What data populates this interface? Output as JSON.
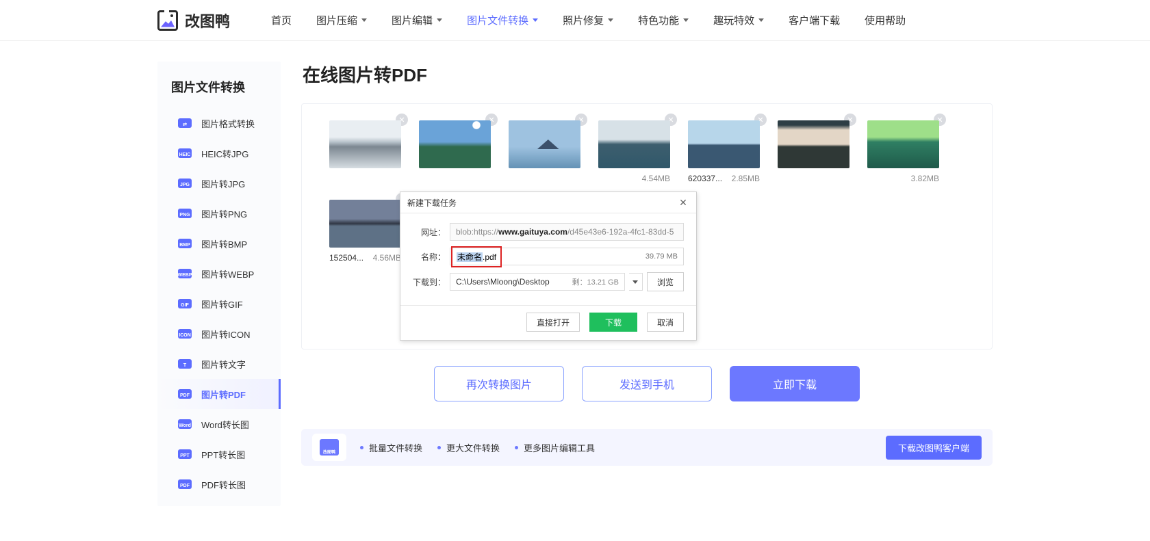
{
  "brand": "改图鸭",
  "header": {
    "nav": [
      {
        "label": "首页",
        "dropdown": false
      },
      {
        "label": "图片压缩",
        "dropdown": true
      },
      {
        "label": "图片编辑",
        "dropdown": true
      },
      {
        "label": "图片文件转换",
        "dropdown": true,
        "active": true
      },
      {
        "label": "照片修复",
        "dropdown": true
      },
      {
        "label": "特色功能",
        "dropdown": true
      },
      {
        "label": "趣玩特效",
        "dropdown": true
      },
      {
        "label": "客户端下载",
        "dropdown": false
      },
      {
        "label": "使用帮助",
        "dropdown": false
      }
    ]
  },
  "sidebar": {
    "title": "图片文件转换",
    "items": [
      {
        "label": "图片格式转换",
        "tag": "⇄"
      },
      {
        "label": "HEIC转JPG",
        "tag": "HEIC"
      },
      {
        "label": "图片转JPG",
        "tag": "JPG"
      },
      {
        "label": "图片转PNG",
        "tag": "PNG"
      },
      {
        "label": "图片转BMP",
        "tag": "BMP"
      },
      {
        "label": "图片转WEBP",
        "tag": "WEBP"
      },
      {
        "label": "图片转GIF",
        "tag": "GIF"
      },
      {
        "label": "图片转ICON",
        "tag": "ICON"
      },
      {
        "label": "图片转文字",
        "tag": "T"
      },
      {
        "label": "图片转PDF",
        "tag": "PDF",
        "active": true
      },
      {
        "label": "Word转长图",
        "tag": "Word"
      },
      {
        "label": "PPT转长图",
        "tag": "PPT"
      },
      {
        "label": "PDF转长图",
        "tag": "PDF"
      }
    ]
  },
  "main": {
    "title": "在线图片转PDF",
    "thumbs": [
      {
        "scenery": "scenery-mist"
      },
      {
        "scenery": "scenery-alpine"
      },
      {
        "scenery": "scenery-lake"
      },
      {
        "name_trunc": "",
        "size": "4.54MB",
        "scenery": "scenery-coast"
      },
      {
        "name_trunc": "620337...",
        "size": "2.85MB",
        "scenery": "scenery-reflect"
      },
      {
        "scenery": "scenery-portrait"
      },
      {
        "name_trunc": "",
        "size": "3.82MB",
        "scenery": "scenery-green"
      },
      {
        "name_trunc": "152504...",
        "size": "4.56MB",
        "scenery": "scenery-mtn"
      }
    ],
    "actions": {
      "again": "再次转换图片",
      "send": "发送到手机",
      "download": "立即下载"
    }
  },
  "promo": {
    "icon_tag": "改图鸭",
    "items": [
      "批量文件转换",
      "更大文件转换",
      "更多图片编辑工具"
    ],
    "button": "下载改图鸭客户端"
  },
  "dialog": {
    "title": "新建下载任务",
    "labels": {
      "url": "网址：",
      "name": "名称：",
      "dest": "下载到："
    },
    "url_prefix": "blob:https://",
    "url_domain": "www.gaituya.com",
    "url_rest": "/d45e43e6-192a-4fc1-83dd-5",
    "filename_stem": "未命名",
    "filename_ext": ".pdf",
    "filesize": "39.79 MB",
    "dest_path": "C:\\Users\\Mloong\\Desktop",
    "dest_remain": "剩：13.21 GB",
    "browse": "浏览",
    "buttons": {
      "open": "直接打开",
      "download": "下载",
      "cancel": "取消"
    }
  }
}
